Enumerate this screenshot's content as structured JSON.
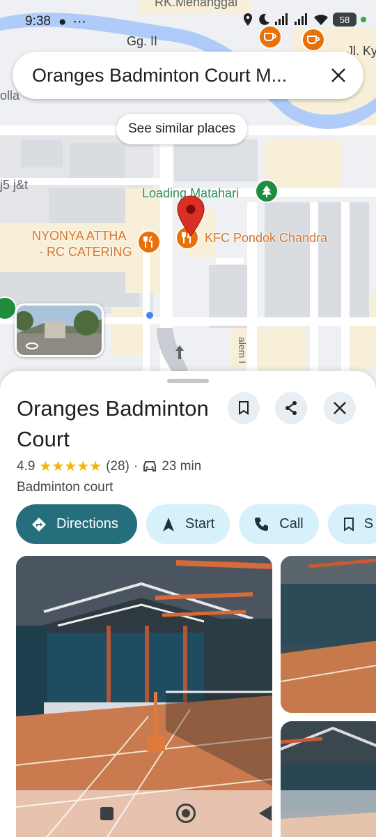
{
  "status_bar": {
    "time": "9:38",
    "left_icons": "● ⋯",
    "battery": "58"
  },
  "map": {
    "search_text": "Oranges Badminton Court M...",
    "similar_places": "See similar places",
    "labels": {
      "rk_menanggal": "RK.Menanggal",
      "gg": "Gg. II",
      "jl_ky": "Jl. Ky",
      "olla": "olla",
      "j5jt": "j5 j&t",
      "loading_matahari": "Loading Matahari",
      "nyonya_line1": "NYONYA ATTHA",
      "nyonya_line2": "- RC CATERING",
      "kfc": "KFC Pondok Chandra",
      "salem": "alem I"
    },
    "icons": [
      "cafe-icon",
      "restaurant-icon",
      "park-icon",
      "location-pin-icon",
      "street-view-icon"
    ]
  },
  "place": {
    "title": "Oranges Badminton Court",
    "rating": "4.9",
    "stars": "★★★★★",
    "reviews": "(28)",
    "separator": "·",
    "drive_time": "23 min",
    "category": "Badminton court",
    "actions": {
      "directions": "Directions",
      "start": "Start",
      "call": "Call",
      "save": "S"
    }
  },
  "colors": {
    "primary_chip": "#256f7c",
    "secondary_chip": "#d7f1fa",
    "star": "#f4b400",
    "pin": "#d93025",
    "poi_orange": "#e8710a",
    "poi_green": "#1e8e3e"
  }
}
